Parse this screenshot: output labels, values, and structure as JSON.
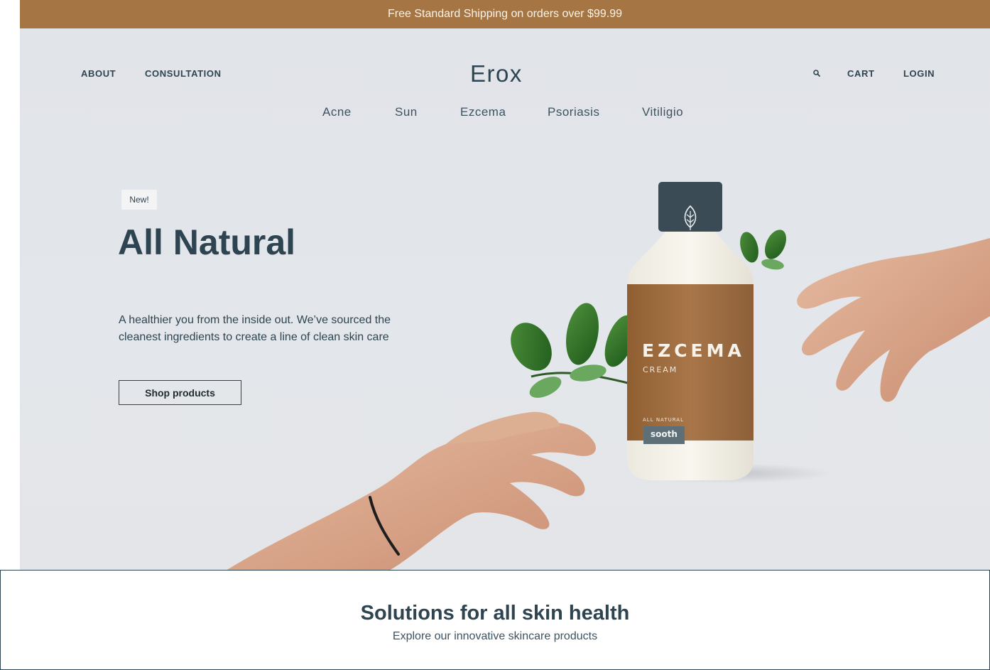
{
  "promo": {
    "text": "Free Standard Shipping on orders over $99.99"
  },
  "header": {
    "logo": "Erox",
    "left_links": [
      "ABOUT",
      "CONSULTATION"
    ],
    "right_links": {
      "cart": "CART",
      "login": "LOGIN"
    },
    "search_icon": "search-icon"
  },
  "categories": [
    "Acne",
    "Sun",
    "Ezcema",
    "Psoriasis",
    "Vitiligio"
  ],
  "hero": {
    "badge": "New!",
    "title": "All Natural",
    "copy": "A healthier you from the inside out. We’ve sourced the cleanest ingredients to create a line of clean skin care",
    "button": "Shop products"
  },
  "product": {
    "name": "EZCEMA",
    "type": "CREAM",
    "tagline": "ALL NATURAL",
    "brand": "sooth"
  },
  "solutions": {
    "title": "Solutions for all skin health",
    "subtitle": "Explore our innovative skincare products"
  },
  "colors": {
    "accent": "#a57544",
    "text": "#2e4450",
    "hero_bg": "#e1e4e9",
    "bottle_label": "#9c6a3b",
    "bottle_cap": "#3a4b55"
  }
}
